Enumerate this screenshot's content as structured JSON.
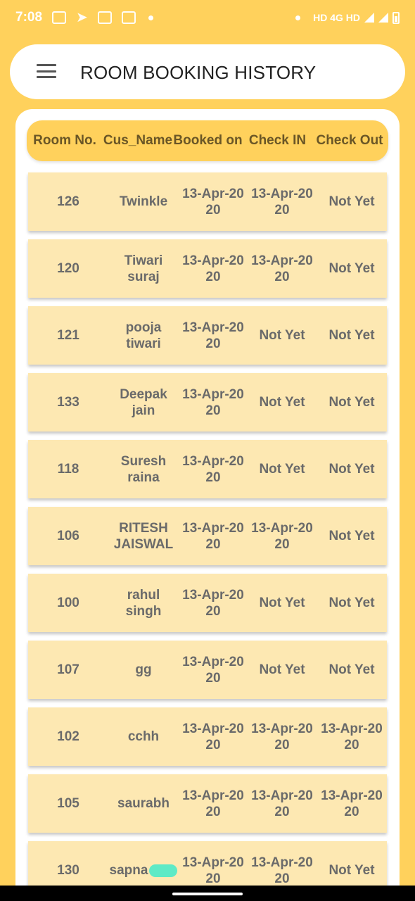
{
  "status_bar": {
    "time": "7:08",
    "network_text": "HD 4G HD"
  },
  "header": {
    "title": "ROOM BOOKING HISTORY",
    "menu_icon": "hamburger-menu-icon"
  },
  "table": {
    "columns": [
      "Room No.",
      "Cus_Name",
      "Booked on",
      "Check IN",
      "Check Out"
    ],
    "rows": [
      {
        "room": "126",
        "name": "Twinkle",
        "booked": "13-Apr-20\n20",
        "checkin": "13-Apr-20\n20",
        "checkout": "Not Yet"
      },
      {
        "room": "120",
        "name": "Tiwari\nsuraj",
        "booked": "13-Apr-20\n20",
        "checkin": "13-Apr-20\n20",
        "checkout": "Not Yet"
      },
      {
        "room": "121",
        "name": "pooja\ntiwari",
        "booked": "13-Apr-20\n20",
        "checkin": "Not Yet",
        "checkout": "Not Yet"
      },
      {
        "room": "133",
        "name": "Deepak\njain",
        "booked": "13-Apr-20\n20",
        "checkin": "Not Yet",
        "checkout": "Not Yet"
      },
      {
        "room": "118",
        "name": "Suresh\nraina",
        "booked": "13-Apr-20\n20",
        "checkin": "Not Yet",
        "checkout": "Not Yet"
      },
      {
        "room": "106",
        "name": "RITESH\nJAISWAL",
        "booked": "13-Apr-20\n20",
        "checkin": "13-Apr-20\n20",
        "checkout": "Not Yet"
      },
      {
        "room": "100",
        "name": "rahul singh",
        "booked": "13-Apr-20\n20",
        "checkin": "Not Yet",
        "checkout": "Not Yet"
      },
      {
        "room": "107",
        "name": "gg",
        "booked": "13-Apr-20\n20",
        "checkin": "Not Yet",
        "checkout": "Not Yet"
      },
      {
        "room": "102",
        "name": "cchh",
        "booked": "13-Apr-20\n20",
        "checkin": "13-Apr-20\n20",
        "checkout": "13-Apr-20\n20"
      },
      {
        "room": "105",
        "name": "saurabh",
        "booked": "13-Apr-20\n20",
        "checkin": "13-Apr-20\n20",
        "checkout": "13-Apr-20\n20"
      },
      {
        "room": "130",
        "name": "sapna",
        "booked": "13-Apr-20\n20",
        "checkin": "13-Apr-20\n20",
        "checkout": "Not Yet"
      }
    ]
  },
  "colors": {
    "background": "#FFD15C",
    "header_bg": "#FFFFFF",
    "row_bg": "#FDE8B2",
    "head_text": "#6A5626",
    "cell_text": "#6A6A6A"
  }
}
